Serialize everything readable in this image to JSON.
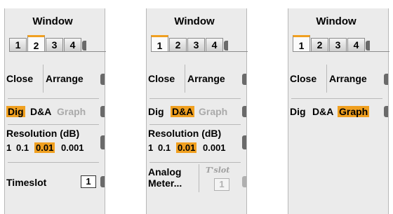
{
  "panels": [
    {
      "title": "Window",
      "tabs": [
        "1",
        "2",
        "3",
        "4"
      ],
      "active_tab": "2",
      "actions": {
        "close": "Close",
        "arrange": "Arrange"
      },
      "modes": {
        "dig": "Dig",
        "da": "D&A",
        "graph": "Graph"
      },
      "selected_mode": "Dig",
      "resolution": {
        "label": "Resolution (dB)",
        "options": [
          "1",
          "0.1",
          "0.01",
          "0.001"
        ],
        "selected": "0.01"
      },
      "timeslot": {
        "label": "Timeslot",
        "value": "1"
      }
    },
    {
      "title": "Window",
      "tabs": [
        "1",
        "2",
        "3",
        "4"
      ],
      "active_tab": "1",
      "actions": {
        "close": "Close",
        "arrange": "Arrange"
      },
      "modes": {
        "dig": "Dig",
        "da": "D&A",
        "graph": "Graph"
      },
      "selected_mode": "D&A",
      "resolution": {
        "label": "Resolution (dB)",
        "options": [
          "1",
          "0.1",
          "0.01",
          "0.001"
        ],
        "selected": "0.01"
      },
      "analog_meter": {
        "line1": "Analog",
        "line2": "Meter..."
      },
      "timeslot_short": {
        "label": "T'slot",
        "value": "1"
      }
    },
    {
      "title": "Window",
      "tabs": [
        "1",
        "2",
        "3",
        "4"
      ],
      "active_tab": "1",
      "actions": {
        "close": "Close",
        "arrange": "Arrange"
      },
      "modes": {
        "dig": "Dig",
        "da": "D&A",
        "graph": "Graph"
      },
      "selected_mode": "Graph"
    }
  ],
  "colors": {
    "accent": "#f0a020",
    "panel_bg": "#ebebeb",
    "disabled_text": "#aaaaaa"
  }
}
